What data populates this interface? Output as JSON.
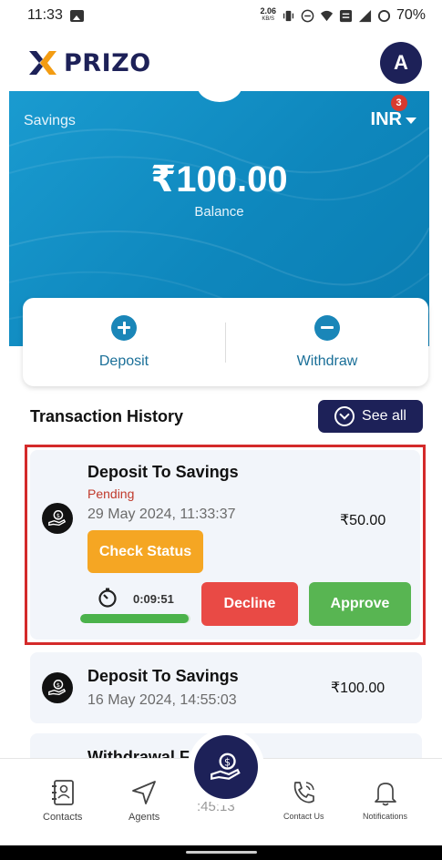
{
  "status_bar": {
    "time": "11:33",
    "net_speed_value": "2.06",
    "net_speed_unit": "KB/S",
    "battery": "70%"
  },
  "header": {
    "logo_text": "PRIZO",
    "avatar_initial": "A"
  },
  "balance": {
    "account_type": "Savings",
    "currency": "INR",
    "notification_count": "3",
    "amount": "₹100.00",
    "label": "Balance"
  },
  "actions": {
    "deposit_label": "Deposit",
    "withdraw_label": "Withdraw"
  },
  "history": {
    "title": "Transaction History",
    "see_all_label": "See all"
  },
  "transactions": [
    {
      "title": "Deposit To Savings",
      "status": "Pending",
      "date": "29 May 2024, 11:33:37",
      "amount": "₹50.00",
      "check_status_label": "Check Status",
      "timer": "0:09:51",
      "timer_progress": 0.98,
      "decline_label": "Decline",
      "approve_label": "Approve"
    },
    {
      "title": "Deposit To Savings",
      "date": "16 May 2024, 14:55:03",
      "amount": "₹100.00"
    },
    {
      "title": "Withdrawal Fr"
    }
  ],
  "bottom_nav": {
    "contacts": "Contacts",
    "agents": "Agents",
    "contact_us": "Contact Us",
    "notifications": "Notifications",
    "partial_time": ":45:13"
  },
  "colors": {
    "brand_navy": "#1d2158",
    "brand_blue": "#1a86b8",
    "pending": "#c0392b",
    "decline": "#e94a45",
    "approve": "#58b552",
    "check_status": "#f5a623"
  }
}
